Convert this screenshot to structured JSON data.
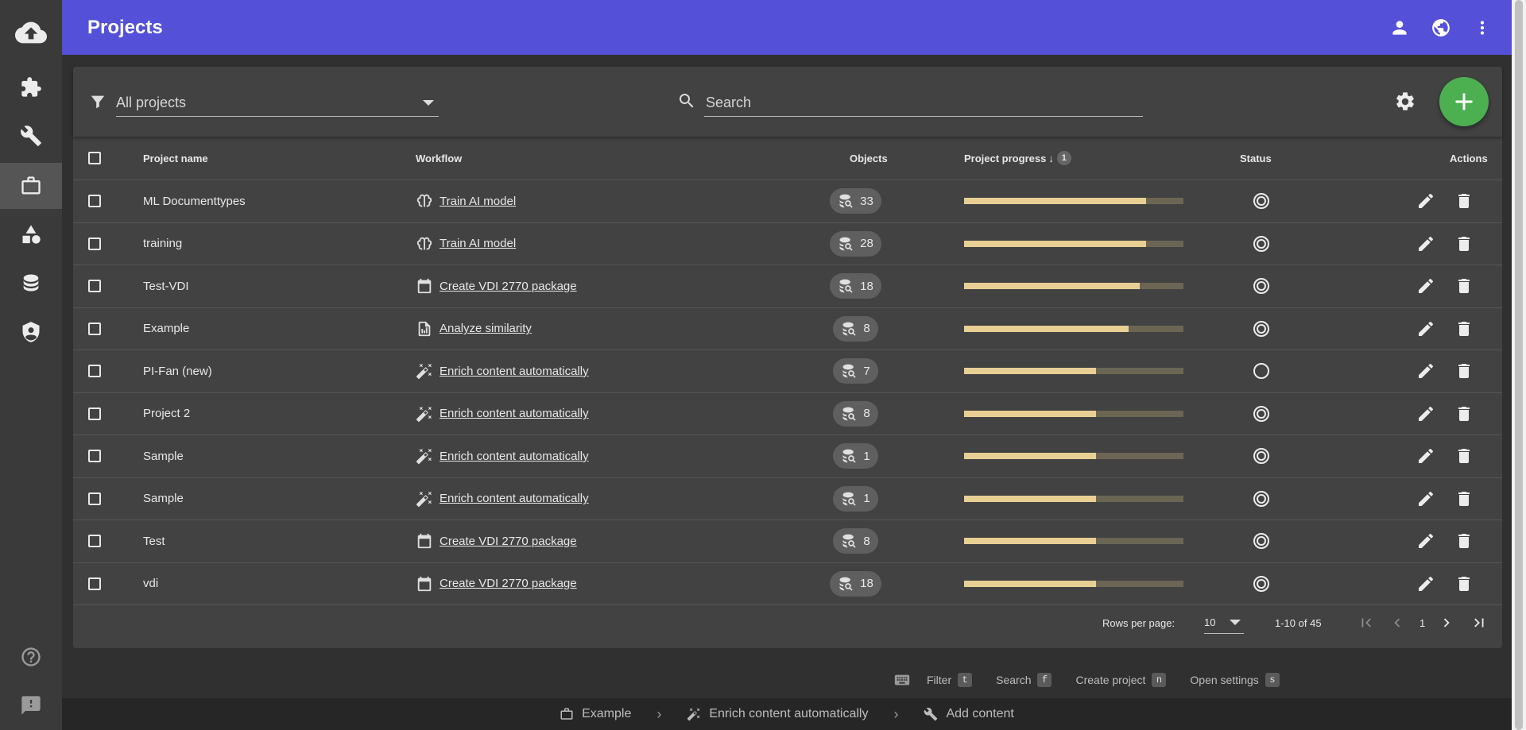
{
  "app": {
    "title": "Projects"
  },
  "sidebar": {
    "items": [
      {
        "name": "cloud-upload",
        "icon": "cloud-upload-icon"
      },
      {
        "name": "extensions",
        "icon": "puzzle-icon"
      },
      {
        "name": "tools",
        "icon": "wrench-icon"
      },
      {
        "name": "projects",
        "icon": "briefcase-icon",
        "active": true
      },
      {
        "name": "shapes",
        "icon": "shapes-icon"
      },
      {
        "name": "database",
        "icon": "database-icon"
      },
      {
        "name": "security",
        "icon": "shield-account-icon"
      },
      {
        "name": "help",
        "icon": "help-icon"
      },
      {
        "name": "feedback",
        "icon": "feedback-icon"
      }
    ]
  },
  "toolbar": {
    "filter_value": "All projects",
    "search_placeholder": "Search"
  },
  "table": {
    "headers": {
      "name": "Project name",
      "workflow": "Workflow",
      "objects": "Objects",
      "progress": "Project progress",
      "sort_index": "1",
      "status": "Status",
      "actions": "Actions"
    },
    "rows": [
      {
        "name": "ML Documenttypes",
        "workflow": "Train AI model",
        "wf_icon": "brain-icon",
        "objects": "33",
        "progress": 0.83,
        "status": "done"
      },
      {
        "name": "training",
        "workflow": "Train AI model",
        "wf_icon": "brain-icon",
        "objects": "28",
        "progress": 0.83,
        "status": "done"
      },
      {
        "name": "Test-VDI",
        "workflow": "Create VDI 2770 package",
        "wf_icon": "package-icon",
        "objects": "18",
        "progress": 0.8,
        "status": "done"
      },
      {
        "name": "Example",
        "workflow": "Analyze similarity",
        "wf_icon": "chart-document-icon",
        "objects": "8",
        "progress": 0.75,
        "status": "done"
      },
      {
        "name": "PI-Fan (new)",
        "workflow": "Enrich content automatically",
        "wf_icon": "magic-wand-icon",
        "objects": "7",
        "progress": 0.6,
        "status": "open"
      },
      {
        "name": "Project 2",
        "workflow": "Enrich content automatically",
        "wf_icon": "magic-wand-icon",
        "objects": "8",
        "progress": 0.6,
        "status": "done"
      },
      {
        "name": "Sample",
        "workflow": "Enrich content automatically",
        "wf_icon": "magic-wand-icon",
        "objects": "1",
        "progress": 0.6,
        "status": "done"
      },
      {
        "name": "Sample",
        "workflow": "Enrich content automatically",
        "wf_icon": "magic-wand-icon",
        "objects": "1",
        "progress": 0.6,
        "status": "done"
      },
      {
        "name": "Test",
        "workflow": "Create VDI 2770 package",
        "wf_icon": "package-icon",
        "objects": "8",
        "progress": 0.6,
        "status": "done"
      },
      {
        "name": "vdi",
        "workflow": "Create VDI 2770 package",
        "wf_icon": "package-icon",
        "objects": "18",
        "progress": 0.6,
        "status": "done"
      }
    ]
  },
  "pagination": {
    "rows_per_page_label": "Rows per page:",
    "rows_per_page": "10",
    "range": "1-10 of 45",
    "page": "1"
  },
  "shortcuts": [
    {
      "label": "Filter",
      "key": "t"
    },
    {
      "label": "Search",
      "key": "f"
    },
    {
      "label": "Create project",
      "key": "n"
    },
    {
      "label": "Open settings",
      "key": "s"
    }
  ],
  "breadcrumb": [
    {
      "label": "Example",
      "icon": "briefcase-icon"
    },
    {
      "label": "Enrich content automatically",
      "icon": "magic-wand-icon"
    },
    {
      "label": "Add content",
      "icon": "wrench-icon"
    }
  ],
  "colors": {
    "accent": "#5450d8",
    "fab": "#4caf50",
    "progress_fill": "#e8cf94",
    "progress_track": "#6b6554"
  }
}
